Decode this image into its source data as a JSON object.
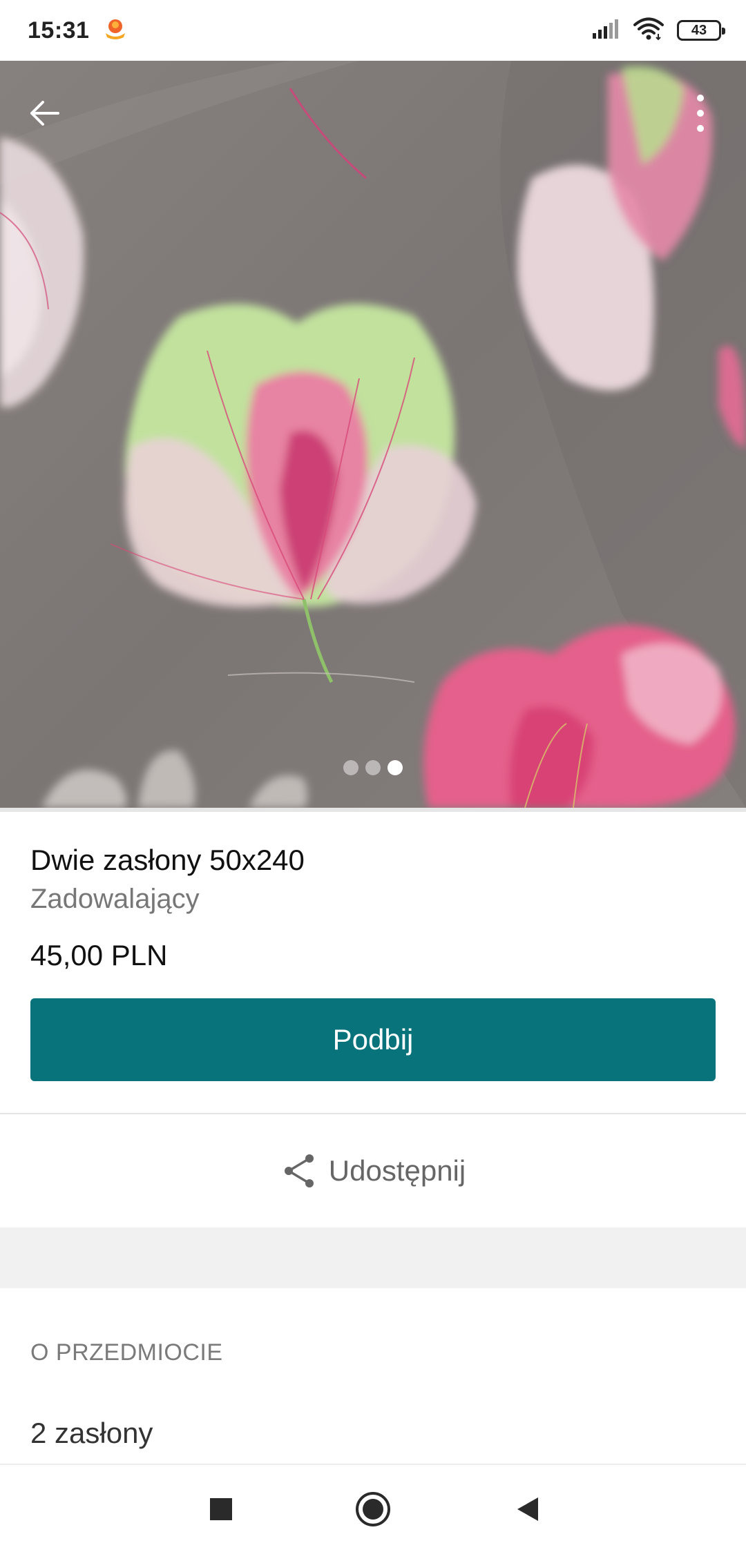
{
  "status_bar": {
    "time": "15:31",
    "battery": "43",
    "icons": [
      "notification-app-icon",
      "signal-icon",
      "wifi-icon",
      "battery-icon"
    ]
  },
  "gallery": {
    "image_count": 3,
    "active_index": 2,
    "icons": [
      "back-arrow-icon",
      "more-vert-icon"
    ]
  },
  "item": {
    "title": "Dwie zasłony 50x240",
    "condition": "Zadowalający",
    "price": "45,00 PLN"
  },
  "actions": {
    "bump_label": "Podbij",
    "share_label": "Udostępnij",
    "share_icon": "share-icon"
  },
  "about": {
    "heading": "O PRZEDMIOCIE",
    "description": "2 zasłony"
  },
  "nav": {
    "icons": [
      "recents-square-icon",
      "home-circle-icon",
      "back-triangle-icon"
    ]
  },
  "colors": {
    "accent": "#08737b",
    "text_primary": "#111111",
    "text_secondary": "#777777",
    "band": "#f1f1f1"
  }
}
